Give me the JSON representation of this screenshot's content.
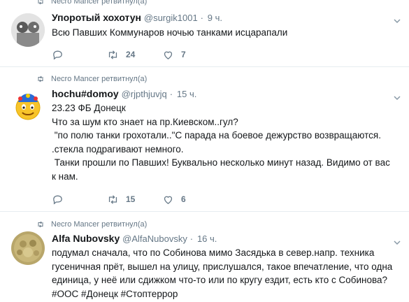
{
  "tweets": [
    {
      "retweeted_by": "",
      "name": "Упоротый хохотун",
      "handle": "@surgik1001",
      "sep": "·",
      "time": "9 ч.",
      "text": "Всю Павших Коммунаров ночью танками исцарапали",
      "replies": "",
      "retweets": "24",
      "likes": "7"
    },
    {
      "retweeted_by": "Necro Mancer ретвитнул(а)",
      "name": "hochu#domoy",
      "handle": "@rjpthjuvjq",
      "sep": "·",
      "time": "15 ч.",
      "text": "23.23 ФБ Донецк\nЧто за шум кто знает на пр.Киевском..гул?\n \"по полю танки грохотали..\"С парада на боевое дежурство возвращаются.\n.стекла подрагивают немного.\n Танки прошли по Павших! Буквально несколько минут назад. Видимо от вас\nк нам.",
      "replies": "",
      "retweets": "15",
      "likes": "6"
    },
    {
      "retweeted_by": "Necro Mancer ретвитнул(а)",
      "name": "Alfa Nubovsky",
      "handle": "@AlfaNubovsky",
      "sep": "·",
      "time": "16 ч.",
      "text": "подумал сначала, что по Собинова мимо Засядька в север.напр. техника\nгусеничная прёт, вышел на улицу, прислушался, такое впечатление, что одна\nединица, у неё или сдижком что-то или по кругу ездит, есть кто с Собинова?\n#ООС #Донецк #Стоптеррор"
    }
  ],
  "top_retweet_label": "Necro Mancer ретвитнул(а)",
  "colors": {
    "gray": "#657786",
    "text": "#14171a",
    "divider": "#e6ecf0"
  }
}
